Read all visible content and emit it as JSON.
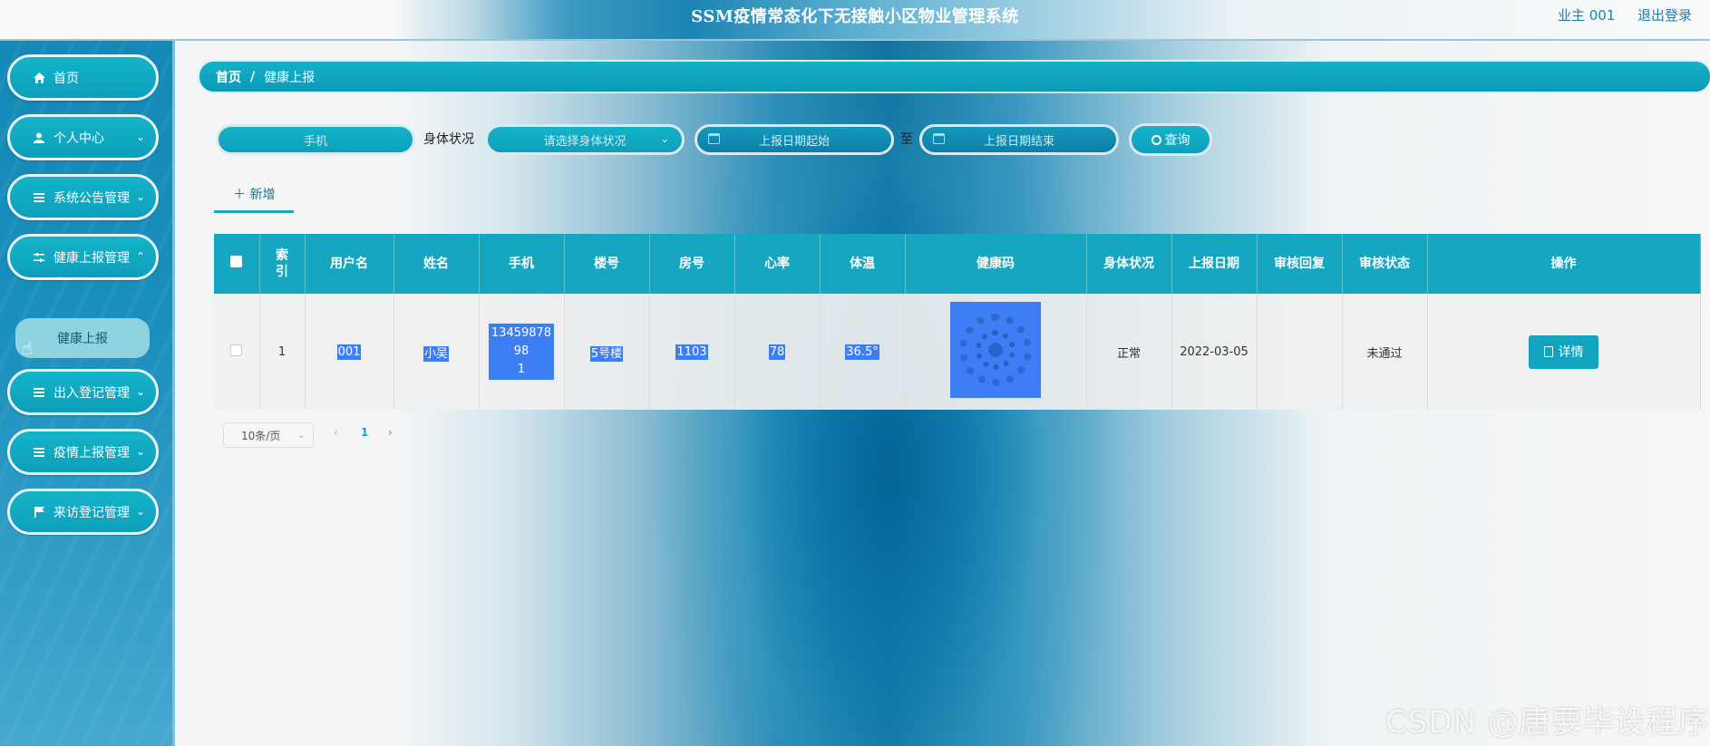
{
  "header": {
    "title": "SSM疫情常态化下无接触小区物业管理系统",
    "user": "业主 001",
    "logout": "退出登录"
  },
  "sidebar": {
    "items": [
      {
        "label": "首页",
        "icon": "home-icon"
      },
      {
        "label": "个人中心",
        "icon": "user-icon"
      },
      {
        "label": "系统公告管理",
        "icon": "list-icon"
      },
      {
        "label": "健康上报管理",
        "icon": "sliders-icon"
      },
      {
        "label": "出入登记管理",
        "icon": "list-icon"
      },
      {
        "label": "疫情上报管理",
        "icon": "list-icon"
      },
      {
        "label": "来访登记管理",
        "icon": "flag-icon"
      }
    ],
    "submenu_active": "健康上报"
  },
  "breadcrumb": {
    "home": "首页",
    "separator": "/",
    "current": "健康上报"
  },
  "search": {
    "phone_placeholder": "手机",
    "status_label": "身体状况",
    "status_placeholder": "请选择身体状况",
    "date_start_placeholder": "上报日期起始",
    "to_label": "至",
    "date_end_placeholder": "上报日期结束",
    "query_label": "查询"
  },
  "toolbar": {
    "add_label": "新增"
  },
  "table": {
    "headers": [
      "",
      "索引",
      "用户名",
      "姓名",
      "手机",
      "楼号",
      "房号",
      "心率",
      "体温",
      "健康码",
      "身体状况",
      "上报日期",
      "审核回复",
      "审核状态",
      "操作"
    ],
    "rows": [
      {
        "index": "1",
        "username": "001",
        "name": "小吴",
        "phone_line1": "1345987898",
        "phone_line2": "1",
        "building": "5号楼",
        "room": "1103",
        "heart_rate": "78",
        "temperature": "36.5°",
        "health_status": "正常",
        "report_date": "2022-03-05",
        "audit_reply": "",
        "audit_status": "未通过",
        "action_label": "详情"
      }
    ]
  },
  "pagination": {
    "page_size": "10条/页",
    "current_page": "1",
    "prev": "‹",
    "next": "›"
  },
  "watermark": "CSDN @唐要毕设程序",
  "colors": {
    "primary": "#14b3c9",
    "selection": "#3d7ef5",
    "sidebar": "#1488b6"
  }
}
